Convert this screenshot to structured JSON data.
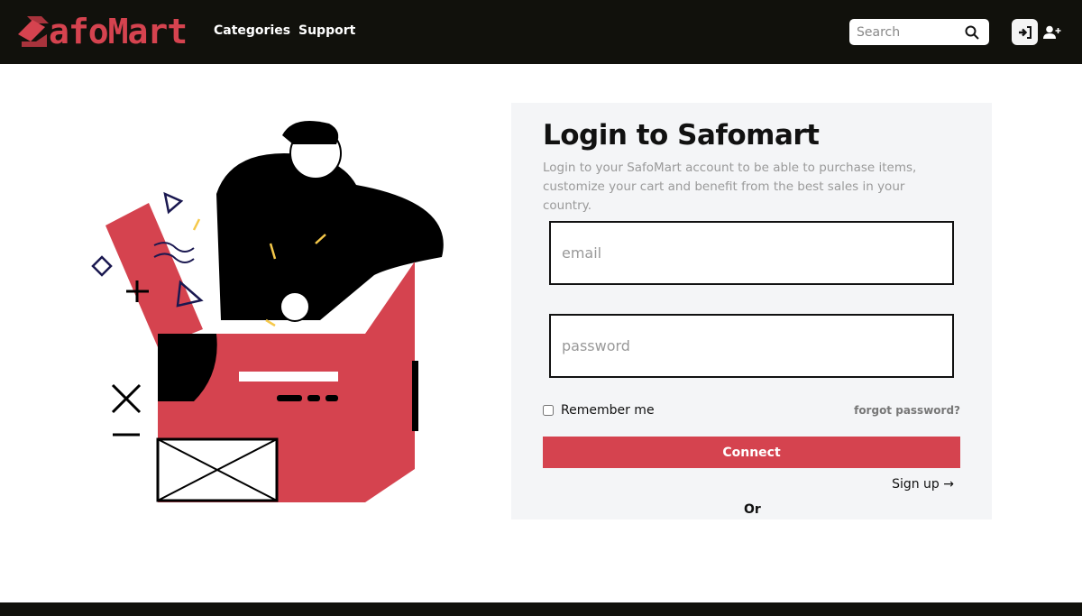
{
  "nav": {
    "logo": "SafoMart",
    "logo_rest": "afoMart",
    "links": [
      "Categories",
      "Support"
    ],
    "search_placeholder": "Search",
    "icons": [
      "search-icon",
      "login-icon",
      "add-user-icon"
    ]
  },
  "login": {
    "title": "Login to Safomart",
    "description": "Login to your SafoMart account to be able to purchase items, customize your cart and benefit from the best sales in your country.",
    "email_placeholder": "email",
    "password_placeholder": "password",
    "remember": "Remember me",
    "forgot": "forgot password?",
    "connect": "Connect",
    "signup": "Sign up",
    "signup_arrow": "→",
    "or": "Or"
  },
  "colors": {
    "brand": "#d5434f",
    "nav_bg": "#11110c",
    "card_bg": "#f4f5f7"
  }
}
